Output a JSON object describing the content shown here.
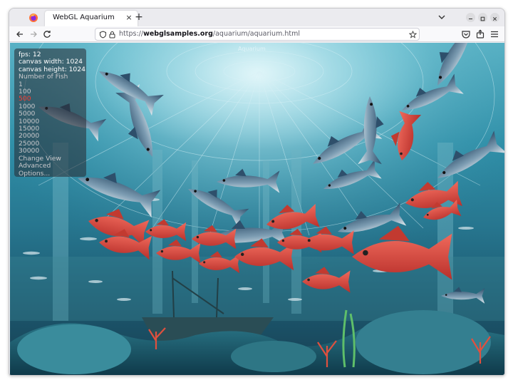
{
  "window": {
    "tab_title": "WebGL Aquarium",
    "tab_close": "×",
    "new_tab": "+"
  },
  "nav": {
    "url_scheme": "https://",
    "url_domain": "webglsamples.org",
    "url_path": "/aquarium/aquarium.html"
  },
  "canvas_title": "Aquarium",
  "stats": {
    "fps_label": "fps: 12",
    "width_label": "canvas width: 1024",
    "height_label": "canvas height: 1024"
  },
  "fish_menu": {
    "header": "Number of Fish",
    "options": [
      "1",
      "100",
      "500",
      "1000",
      "5000",
      "10000",
      "15000",
      "20000",
      "25000",
      "30000"
    ],
    "selected": "500"
  },
  "links": {
    "change_view": "Change View",
    "advanced": "Advanced",
    "options": "Options..."
  },
  "colors": {
    "selected_option": "#ff3a2e",
    "water_top": "#5ab3c6",
    "water_bottom": "#173f52",
    "fish_red": "#d8443c",
    "fish_tuna": "#4a6e8c"
  },
  "icons": [
    "firefox-icon",
    "tab-close-icon",
    "new-tab-icon",
    "list-all-tabs-icon",
    "minimize-icon",
    "maximize-icon",
    "close-window-icon",
    "back-icon",
    "forward-icon",
    "reload-icon",
    "shield-icon",
    "lock-icon",
    "bookmark-star-icon",
    "pocket-icon",
    "share-icon",
    "menu-icon"
  ]
}
